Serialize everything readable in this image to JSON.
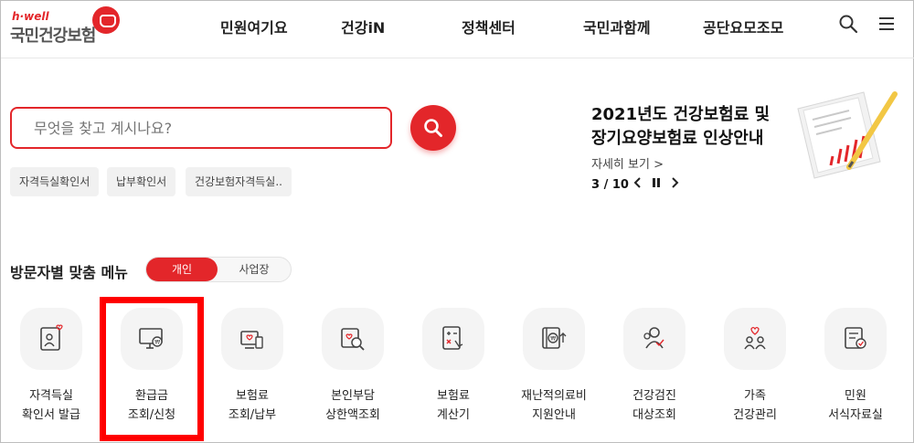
{
  "brand": {
    "tagline": "h·well",
    "name": "국민건강보험",
    "color": "#e3262a"
  },
  "nav": [
    "민원여기요",
    "건강iN",
    "정책센터",
    "국민과함께",
    "공단요모조모"
  ],
  "header_icons": [
    "search-icon",
    "hamburger-menu-icon"
  ],
  "search": {
    "placeholder": "무엇을 찾고 계시나요?"
  },
  "quick_links": [
    "자격득실확인서",
    "납부확인서",
    "건강보험자격득실.."
  ],
  "banner": {
    "title_line1": "2021년도 건강보험료 및",
    "title_line2": "장기요양보험료 인상안내",
    "more": "자세히 보기 >",
    "pager": "3 / 10"
  },
  "menu": {
    "title": "방문자별 맞춤 메뉴",
    "toggle": {
      "selected": "개인",
      "other": "사업장"
    },
    "items": [
      {
        "line1": "자격득실",
        "line2": "확인서 발급",
        "icon": "id-card-heart-icon"
      },
      {
        "line1": "환급금",
        "line2": "조회/신청",
        "icon": "monitor-refund-icon"
      },
      {
        "line1": "보험료",
        "line2": "조회/납부",
        "icon": "bill-payment-icon"
      },
      {
        "line1": "본인부담",
        "line2": "상한액조회",
        "icon": "search-heart-icon"
      },
      {
        "line1": "보험료",
        "line2": "계산기",
        "icon": "calculator-icon"
      },
      {
        "line1": "재난적의료비",
        "line2": "지원안내",
        "icon": "book-won-icon"
      },
      {
        "line1": "건강검진",
        "line2": "대상조회",
        "icon": "people-check-icon"
      },
      {
        "line1": "가족",
        "line2": "건강관리",
        "icon": "family-heart-icon"
      },
      {
        "line1": "민원",
        "line2": "서식자료실",
        "icon": "document-check-icon"
      }
    ]
  },
  "highlight_color": "#ff0000"
}
